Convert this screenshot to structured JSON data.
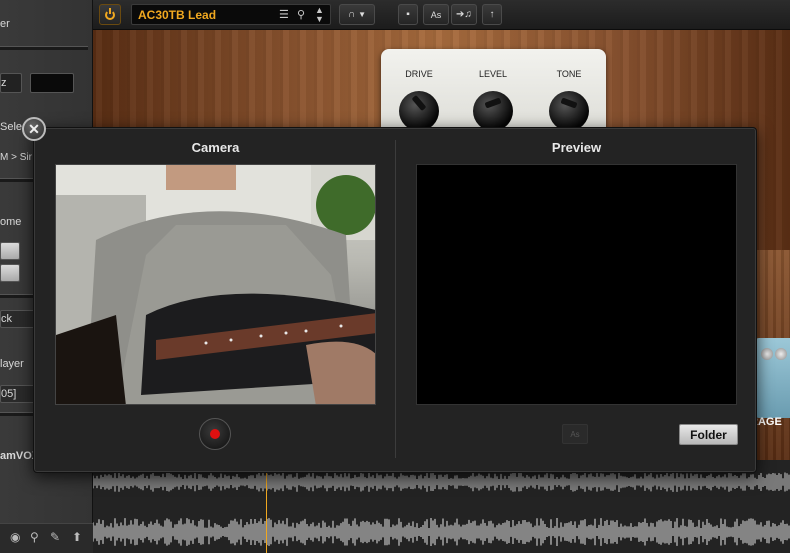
{
  "toolbar": {
    "preset_name": "AC30TB Lead",
    "save_as_label": "As"
  },
  "amp": {
    "knobs": [
      "DRIVE",
      "LEVEL",
      "TONE"
    ]
  },
  "left_panel": {
    "items": [
      "er",
      "z",
      "Selec",
      "M > Sir",
      "ome",
      "ck",
      "layer",
      "05]",
      "amVOX"
    ]
  },
  "pedal": {
    "label": "RAGE"
  },
  "dialog": {
    "camera_title": "Camera",
    "preview_title": "Preview",
    "folder_label": "Folder",
    "close_glyph": "✕",
    "save_as_label": "As"
  },
  "colors": {
    "accent": "#f0a820",
    "record": "#e01010"
  }
}
